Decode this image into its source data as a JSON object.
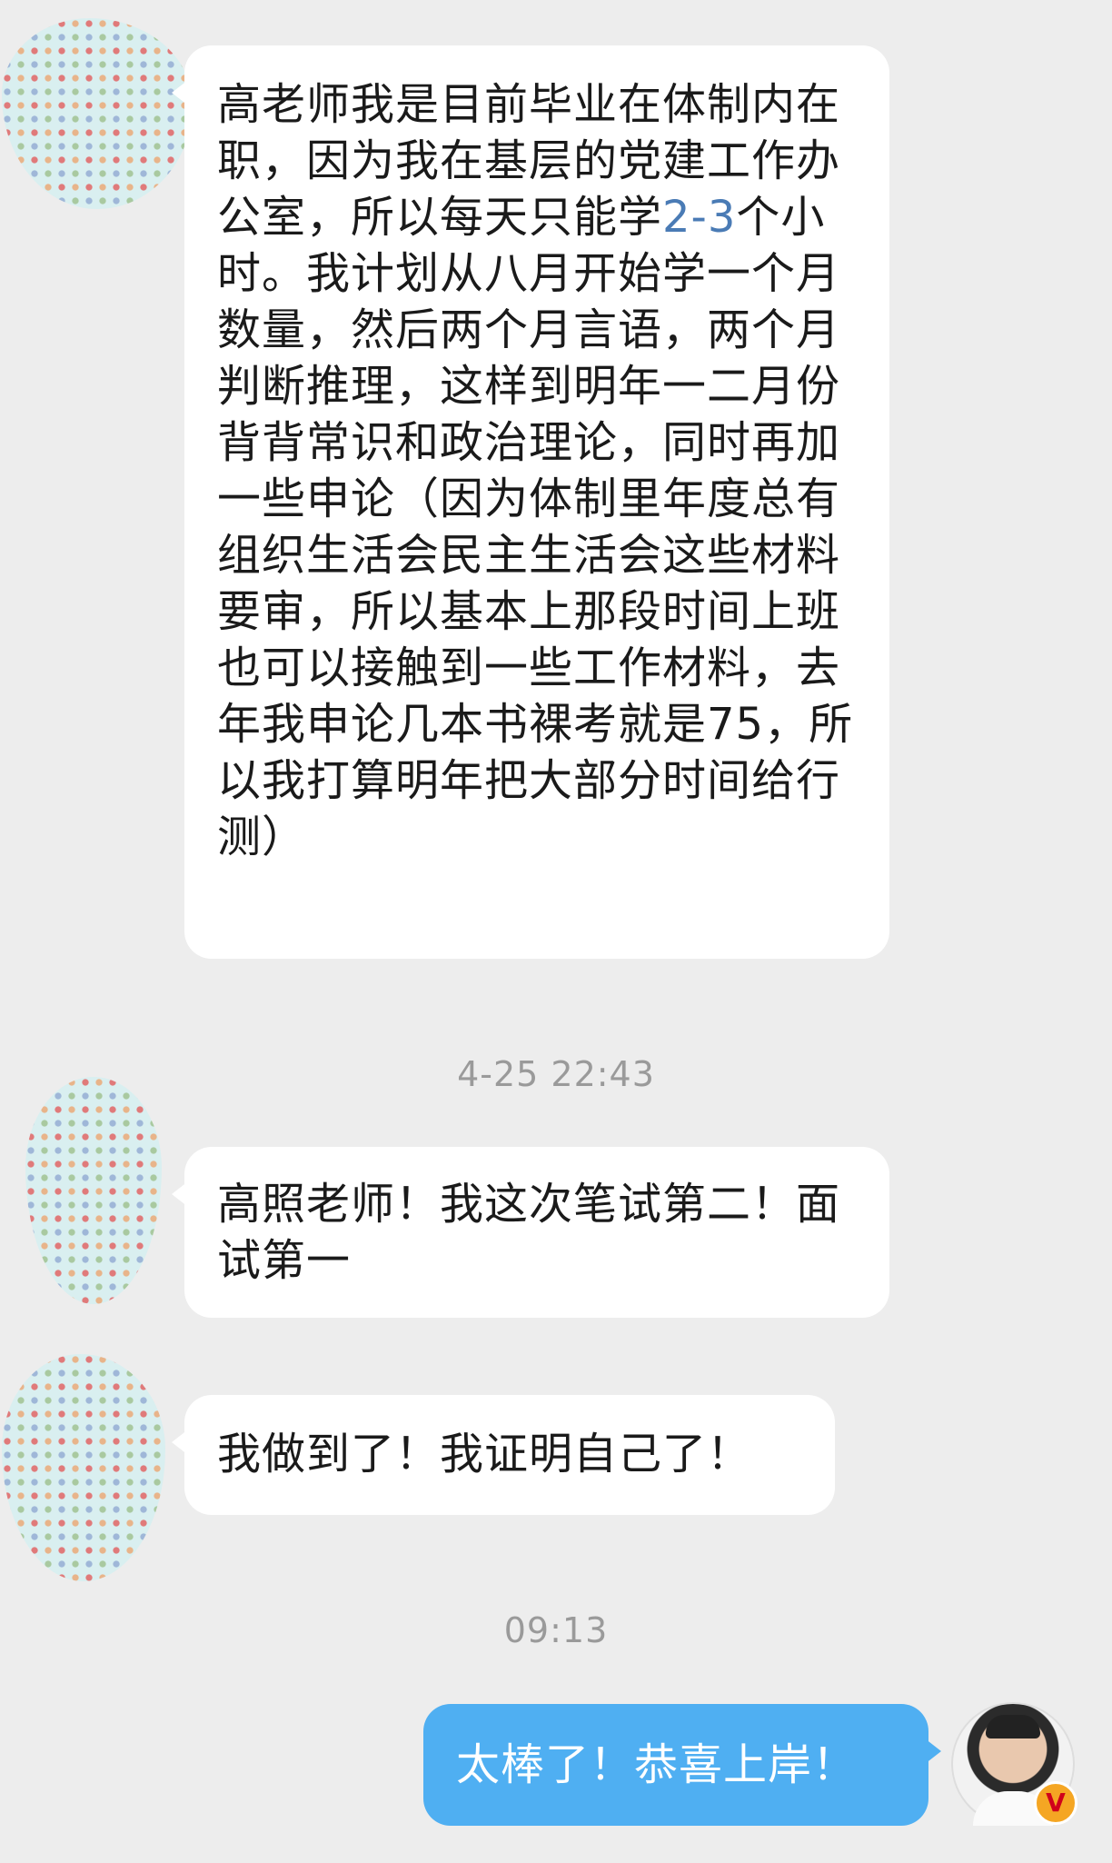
{
  "messages": [
    {
      "text_pre": "高老师我是目前毕业在体制内在职，因为我在基层的党建工作办公室，所以每天只能学",
      "text_num": "2-3",
      "text_post": "个小时。我计划从八月开始学一个月数量，然后两个月言语，两个月判断推理，这样到明年一二月份背背常识和政治理论，同时再加一些申论（因为体制里年度总有组织生活会民主生活会这些材料要审，所以基本上那段时间上班也可以接触到一些工作材料，去年我申论几本书裸考就是75，所以我打算明年把大部分时间给行测）"
    },
    {
      "text": "高照老师！我这次笔试第二！面试第一"
    },
    {
      "text": "我做到了！我证明自己了！"
    },
    {
      "text": "太棒了！恭喜上岸！"
    }
  ],
  "timestamps": {
    "first": "4-25 22:43",
    "second": "09:13"
  },
  "badge": {
    "label": "V"
  },
  "colors": {
    "background": "#ededed",
    "incoming_bubble": "#ffffff",
    "outgoing_bubble": "#4faff2",
    "timestamp": "#9a9a9a",
    "number_link": "#4a7bb5"
  },
  "icons": {
    "contact_avatar": "blurred-polka-dot-avatar-icon",
    "self_avatar": "profile-photo-icon",
    "verified_badge": "verified-v-badge-icon"
  }
}
